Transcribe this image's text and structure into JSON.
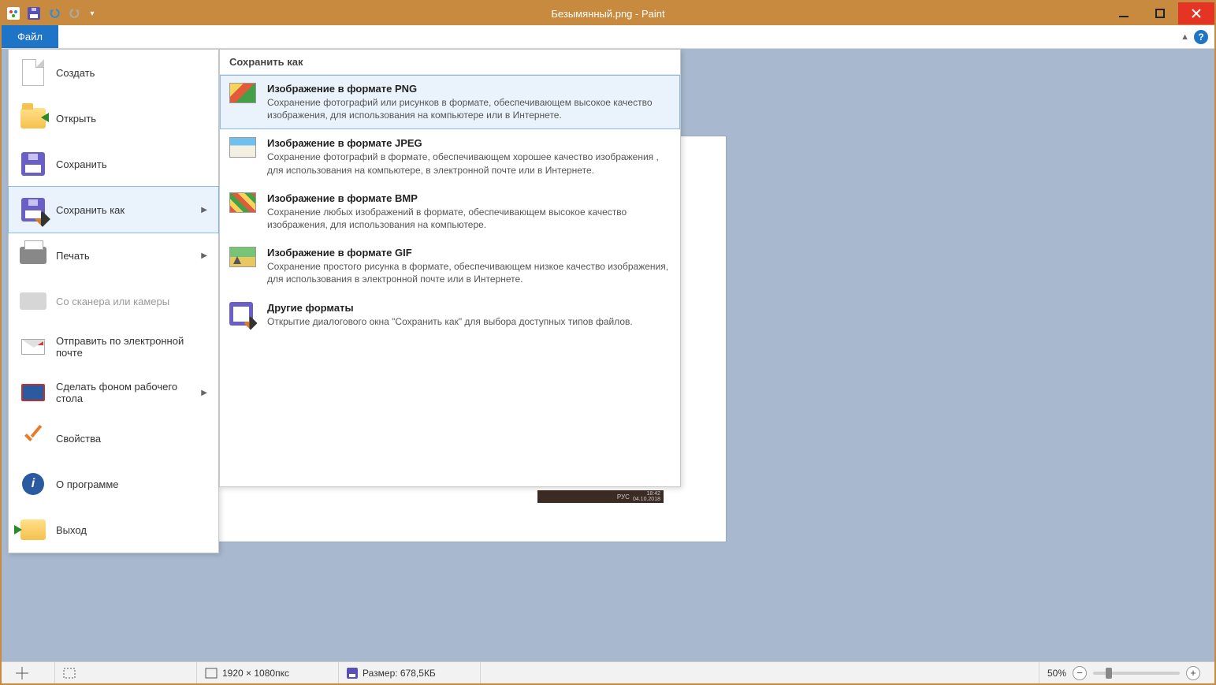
{
  "title": "Безымянный.png - Paint",
  "qat": {
    "save_tip": "save",
    "undo_tip": "undo",
    "redo_tip": "redo"
  },
  "ribbon": {
    "file_label": "Файл"
  },
  "file_menu": {
    "create": "Создать",
    "open": "Открыть",
    "save": "Сохранить",
    "save_as": "Сохранить как",
    "print": "Печать",
    "scanner": "Со сканера или камеры",
    "email": "Отправить по электронной почте",
    "desktop_bg": "Сделать фоном рабочего стола",
    "properties": "Свойства",
    "about": "О программе",
    "exit": "Выход"
  },
  "submenu": {
    "header": "Сохранить как",
    "png": {
      "title": "Изображение в формате PNG",
      "desc": "Сохранение фотографий или рисунков в формате, обеспечивающем высокое качество изображения, для использования на компьютере или в Интернете."
    },
    "jpeg": {
      "title": "Изображение в формате JPEG",
      "desc": "Сохранение фотографий в формате, обеспечивающем хорошее качество изображения , для использования на компьютере, в электронной почте или в Интернете."
    },
    "bmp": {
      "title": "Изображение в формате BMP",
      "desc": "Сохранение любых изображений в формате, обеспечивающем высокое качество изображения, для использования на компьютере."
    },
    "gif": {
      "title": "Изображение в формате GIF",
      "desc": "Сохранение простого рисунка в формате, обеспечивающем низкое качество изображения, для использования в электронной почте или в Интернете."
    },
    "other": {
      "title": "Другие форматы",
      "desc": "Открытие диалогового окна \"Сохранить как\" для выбора доступных типов файлов."
    }
  },
  "statusbar": {
    "dimensions": "1920 × 1080пкс",
    "size_label": "Размер: 678,5КБ",
    "zoom": "50%"
  },
  "tray": {
    "lang": "РУС",
    "time": "18:42",
    "date": "04.10.2018"
  }
}
